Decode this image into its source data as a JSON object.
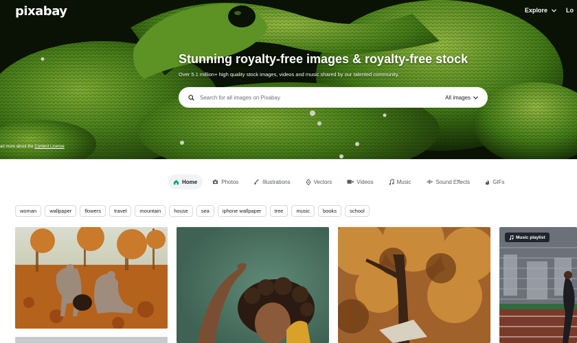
{
  "header": {
    "logo": "pixabay",
    "explore_label": "Explore",
    "login_label": "Lo"
  },
  "hero": {
    "headline": "Stunning royalty-free images & royalty-free stock",
    "subline": "Over 5.1 million+ high quality stock images, videos and music shared by our talented community.",
    "license_prefix": "ad more about the ",
    "license_link": "Content License"
  },
  "search": {
    "placeholder": "Search for all images on Pixabay",
    "filter_value": "All images"
  },
  "tabs": [
    {
      "label": "Home",
      "icon": "home-icon",
      "active": true
    },
    {
      "label": "Photos",
      "icon": "camera-icon"
    },
    {
      "label": "Illustrations",
      "icon": "brush-icon"
    },
    {
      "label": "Vectors",
      "icon": "pen-nib-icon"
    },
    {
      "label": "Videos",
      "icon": "video-icon"
    },
    {
      "label": "Music",
      "icon": "music-note-icon"
    },
    {
      "label": "Sound Effects",
      "icon": "waveform-icon"
    },
    {
      "label": "GIFs",
      "icon": "flame-icon"
    }
  ],
  "tags": [
    "woman",
    "wallpaper",
    "flowers",
    "travel",
    "mountain",
    "house",
    "sea",
    "iphone wallpaper",
    "tree",
    "music",
    "books",
    "school"
  ],
  "gallery": {
    "music_badge": "Music playlist"
  },
  "colors": {
    "accent": "#00ab6b",
    "text": "#191b26",
    "chip_border": "#d7d9df"
  }
}
